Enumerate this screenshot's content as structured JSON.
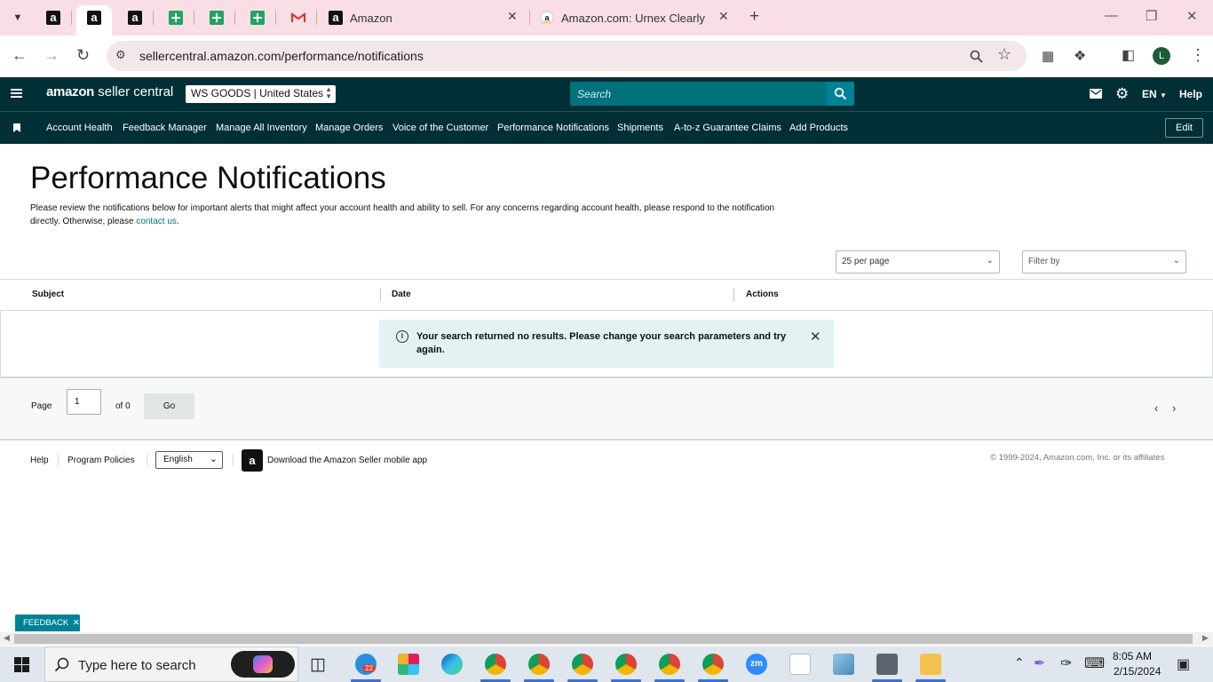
{
  "browser": {
    "tabs": [
      {
        "icon": "amazon-favicon",
        "title": ""
      },
      {
        "icon": "amazon-favicon",
        "title": ""
      },
      {
        "icon": "amazon-favicon",
        "title": ""
      },
      {
        "icon": "sheets-favicon",
        "title": ""
      },
      {
        "icon": "sheets-favicon",
        "title": ""
      },
      {
        "icon": "sheets-favicon",
        "title": ""
      },
      {
        "icon": "gmail-favicon",
        "title": ""
      },
      {
        "icon": "amazon-favicon",
        "title": "Amazon"
      },
      {
        "icon": "amazon-favicon",
        "title": "Amazon.com: Urnex Clearly Co"
      }
    ],
    "url": "sellercentral.amazon.com/performance/notifications",
    "profile_initial": "L"
  },
  "header": {
    "logo_brand": "amazon",
    "logo_suffix": "seller central",
    "account": "WS GOODS | United States",
    "search_placeholder": "Search",
    "language": "EN",
    "help": "Help"
  },
  "nav": {
    "items": [
      "Account Health",
      "Feedback Manager",
      "Manage All Inventory",
      "Manage Orders",
      "Voice of the Customer",
      "Performance Notifications",
      "Shipments",
      "A-to-z Guarantee Claims",
      "Add Products"
    ],
    "edit_label": "Edit"
  },
  "main": {
    "title": "Performance Notifications",
    "description": "Please review the notifications below for important alerts that might affect your account health and ability to sell. For any concerns regarding account health, please respond to the notification directly. Otherwise, please",
    "contact_link": "contact us",
    "description_end": ".",
    "per_page": "25 per page",
    "filter_placeholder": "Filter by",
    "columns": [
      "Subject",
      "Date",
      "Actions"
    ],
    "alert": "Your search returned no results. Please change your search parameters and try again.",
    "pager": {
      "page_label": "Page",
      "page_value": "1",
      "of_label": "of 0",
      "go_label": "Go"
    }
  },
  "footer": {
    "help": "Help",
    "policies": "Program Policies",
    "language": "English",
    "app_link": "Download the Amazon Seller mobile app",
    "copyright": "© 1999-2024, Amazon.com, Inc. or its affiliates"
  },
  "feedback": "FEEDBACK",
  "taskbar": {
    "search_placeholder": "Type here to search",
    "time": "8:05 AM",
    "date": "2/15/2024",
    "badge": "22"
  },
  "colors": {
    "header_bg": "#002f36",
    "accent_teal": "#008296",
    "link": "#007185",
    "tabstrip_bg": "#f9dfe5"
  }
}
